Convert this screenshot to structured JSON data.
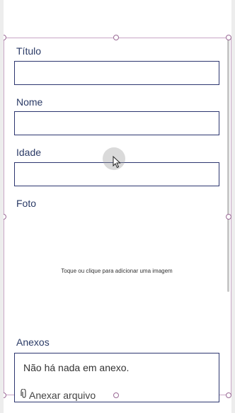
{
  "form": {
    "fields": [
      {
        "label": "Título",
        "value": ""
      },
      {
        "label": "Nome",
        "value": ""
      },
      {
        "label": "Idade",
        "value": ""
      }
    ],
    "photo": {
      "label": "Foto",
      "placeholder": "Toque ou clique para adicionar uma imagem"
    },
    "attachments": {
      "label": "Anexos",
      "empty_text": "Não há nada em anexo.",
      "attach_label": "Anexar arquivo"
    }
  },
  "icons": {
    "attach": "paperclip-icon",
    "cursor": "mouse-pointer-icon"
  },
  "colors": {
    "label_text": "#2a3a66",
    "input_border": "#2d3670",
    "selection_border": "#9a6a96"
  }
}
